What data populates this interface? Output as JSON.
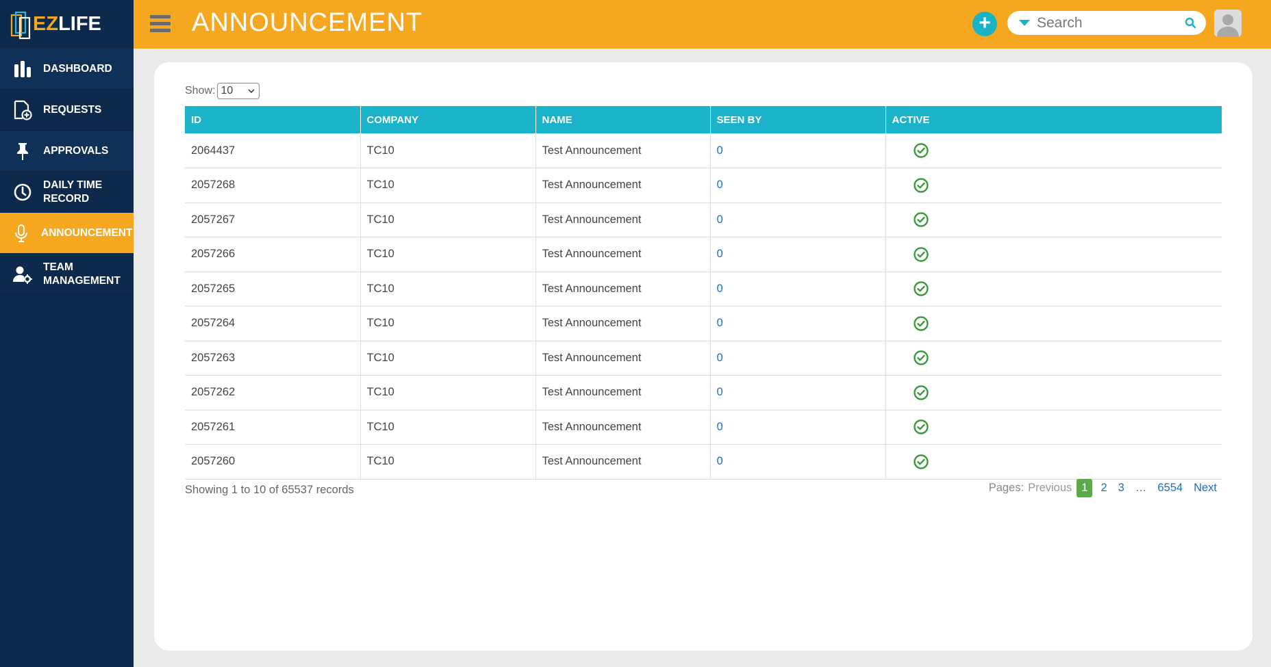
{
  "app": {
    "logo_text_a": "EZ",
    "logo_text_b": "LIFE"
  },
  "sidebar": {
    "items": [
      {
        "icon": "bar-chart-icon",
        "label": "DASHBOARD"
      },
      {
        "icon": "file-plus-icon",
        "label": "REQUESTS"
      },
      {
        "icon": "pin-icon",
        "label": "APPROVALS"
      },
      {
        "icon": "clock-icon",
        "label_line1": "DAILY TIME",
        "label_line2": "RECORD"
      },
      {
        "icon": "microphone-icon",
        "label": "ANNOUNCEMENT",
        "active": true
      },
      {
        "icon": "user-gear-icon",
        "label_line1": "TEAM",
        "label_line2": "MANAGEMENT"
      }
    ]
  },
  "header": {
    "title": "ANNOUNCEMENT",
    "search_placeholder": "Search"
  },
  "table": {
    "show_label": "Show:",
    "page_size": "10",
    "columns": [
      "ID",
      "COMPANY",
      "NAME",
      "SEEN BY",
      "ACTIVE"
    ],
    "rows": [
      {
        "id": "2064437",
        "company": "TC10",
        "name": "Test Announcement",
        "seen_by": "0",
        "active": true
      },
      {
        "id": "2057268",
        "company": "TC10",
        "name": "Test Announcement",
        "seen_by": "0",
        "active": true
      },
      {
        "id": "2057267",
        "company": "TC10",
        "name": "Test Announcement",
        "seen_by": "0",
        "active": true
      },
      {
        "id": "2057266",
        "company": "TC10",
        "name": "Test Announcement",
        "seen_by": "0",
        "active": true
      },
      {
        "id": "2057265",
        "company": "TC10",
        "name": "Test Announcement",
        "seen_by": "0",
        "active": true
      },
      {
        "id": "2057264",
        "company": "TC10",
        "name": "Test Announcement",
        "seen_by": "0",
        "active": true
      },
      {
        "id": "2057263",
        "company": "TC10",
        "name": "Test Announcement",
        "seen_by": "0",
        "active": true
      },
      {
        "id": "2057262",
        "company": "TC10",
        "name": "Test Announcement",
        "seen_by": "0",
        "active": true
      },
      {
        "id": "2057261",
        "company": "TC10",
        "name": "Test Announcement",
        "seen_by": "0",
        "active": true
      },
      {
        "id": "2057260",
        "company": "TC10",
        "name": "Test Announcement",
        "seen_by": "0",
        "active": true
      }
    ],
    "summary": "Showing 1 to 10 of 65537 records"
  },
  "pagination": {
    "label": "Pages:",
    "previous": "Previous",
    "pages": [
      "1",
      "2",
      "3"
    ],
    "current": "1",
    "ellipsis": "…",
    "last": "6554",
    "next": "Next"
  },
  "colors": {
    "header_bg": "#f5a81f",
    "sidebar_bg": "#0d2a4c",
    "table_header_bg": "#1ab3c9",
    "active_check": "#3a9a3a",
    "current_page": "#5da84a"
  }
}
